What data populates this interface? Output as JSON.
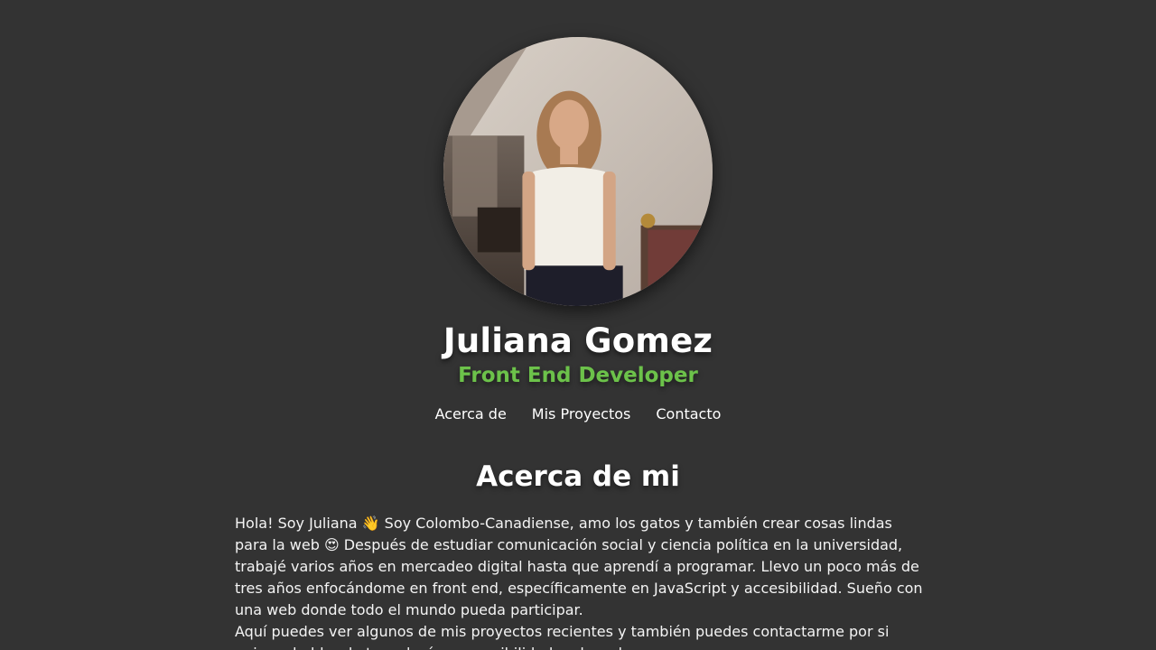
{
  "profile": {
    "name": "Juliana Gomez",
    "role": "Front End Developer",
    "role_color": "#6cc24a"
  },
  "nav": {
    "items": [
      {
        "label": "Acerca de"
      },
      {
        "label": "Mis Proyectos"
      },
      {
        "label": "Contacto"
      }
    ]
  },
  "about": {
    "title": "Acerca de mi",
    "paragraph_1": "Hola! Soy Juliana 👋 Soy Colombo-Canadiense, amo los gatos y también crear cosas lindas para la web 😍 Después de estudiar comunicación social y ciencia política en la universidad, trabajé varios años en mercadeo digital hasta que aprendí a programar. Llevo un poco más de tres años enfocándome en front end, específicamente en JavaScript y accesibilidad. Sueño con una web donde todo el mundo pueda participar.",
    "paragraph_2": "Aquí puedes ver algunos de mis proyectos recientes y también puedes contactarme por si quieres hablar de tecnología o accesibilidad en la web."
  },
  "theme": {
    "background": "#333333",
    "text": "#ffffff"
  }
}
